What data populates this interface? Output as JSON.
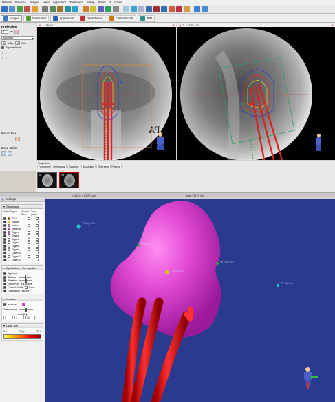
{
  "menu": [
    "Patient",
    "Sources",
    "Images",
    "View",
    "Applicator",
    "Treatment",
    "Setup",
    "Show",
    "?",
    "cruise"
  ],
  "tabs": [
    {
      "label": "Images",
      "color": "#3a78c9"
    },
    {
      "label": "Collimation",
      "color": "#5a9a3a"
    },
    {
      "label": "Applicators",
      "color": "#2a5fb0"
    },
    {
      "label": "Dwell Times",
      "color": "#c03030"
    },
    {
      "label": "Control Points",
      "color": "#c87a1a"
    },
    {
      "label": "3BD",
      "color": "#2f8f8f"
    }
  ],
  "left_panel": {
    "title": "Projection",
    "size_value": "5",
    "size_unit": "cm",
    "mode": "Isocenter",
    "w_label": "40",
    "w_field": "Vdkp",
    "h_label": "40",
    "h_field": "Vulp",
    "square_pixels": "Square Pixels",
    "recon_box": "Recon Box",
    "dose_matrix": "Dose Matrix"
  },
  "viewports": [
    {
      "header": "1 - AP, KE",
      "overlay_text": "PA"
    },
    {
      "header": "2 - LAT RL, OE",
      "overlay_text": ""
    }
  ],
  "projection_panel": {
    "title": "Projection",
    "tabs": [
      "Projection",
      "Orthogonal",
      "Overview",
      "Secondary",
      "Reference",
      "Planes"
    ],
    "thumbs": [
      "AP",
      "LAT"
    ]
  },
  "status": {
    "coords": "x: 18.03 × 12.20 [cm]",
    "dose": "Dose: 0.179 Gy"
  },
  "settings": {
    "title": "Settings",
    "structures": {
      "title": "Structures",
      "headers": [
        "Select Organs",
        "Surface Dose",
        "Trans-parent"
      ],
      "organs": [
        {
          "name": "PTV",
          "color": "#e02020"
        },
        {
          "name": "bladder",
          "color": "#e8c020"
        },
        {
          "name": "rectum",
          "color": "#e070c0"
        },
        {
          "name": "Urethrate",
          "color": "#c030c0"
        },
        {
          "name": "Organ4",
          "color": "#d040d0"
        },
        {
          "name": "Organ5",
          "color": "#dddddd"
        },
        {
          "name": "Organ6",
          "color": "#dddddd"
        },
        {
          "name": "Organ7",
          "color": "#dddddd"
        },
        {
          "name": "Organ8",
          "color": "#dddddd"
        },
        {
          "name": "Organ9",
          "color": "#dddddd"
        },
        {
          "name": "Organ10",
          "color": "#dddddd"
        },
        {
          "name": "Organ11",
          "color": "#dddddd"
        },
        {
          "name": "Organ12",
          "color": "#dddddd"
        }
      ]
    },
    "applicators": {
      "title": "Applicators / Corrugation",
      "items": [
        "Applicat",
        "Shields",
        "Sheaths",
        "Dwell Pos",
        "Control Points",
        "Orientation Figurine"
      ],
      "extra": [
        "Active",
        "Dose"
      ]
    },
    "isodose": {
      "title": "Isodose",
      "isodose_label": "Isodose",
      "transparent_label": "Transparent",
      "level_label": "Level [Gy]",
      "level_values": [
        "1",
        "7",
        "20"
      ]
    },
    "color_bar": {
      "title": "Color Bar",
      "min": "0.0",
      "unit": "Gray",
      "max": "20.0"
    }
  },
  "scene": {
    "labels": [
      "TP 1 (0.0 M...)",
      "TP 3 (0.0...)",
      "TP 2 (0.0...)",
      "TP 2 (0.0 M...)",
      "TP 4 (0.0...)"
    ]
  }
}
